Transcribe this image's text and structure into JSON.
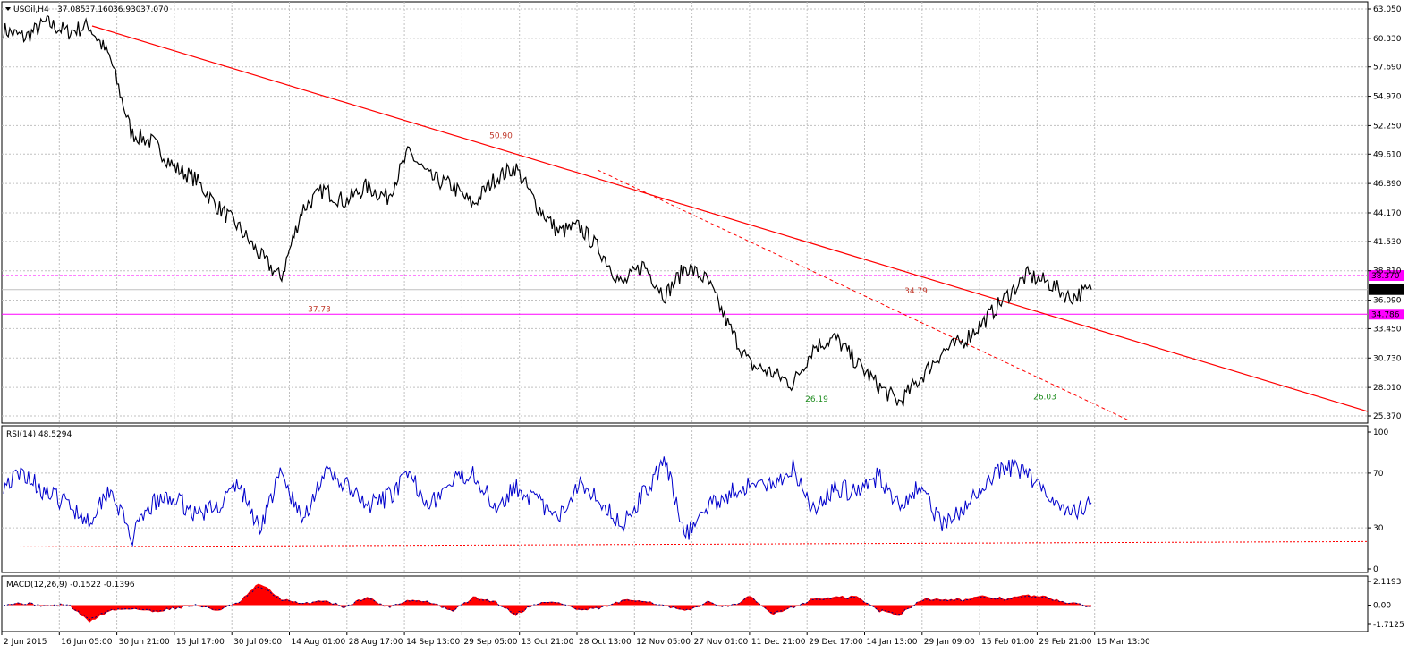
{
  "chart_data": {
    "type": "line",
    "symbol_label": "USOil,H4",
    "ohlc": [
      "37.085",
      "37.160",
      "36.930",
      "37.070"
    ],
    "price_axis": {
      "ticks": [
        "63.050",
        "60.330",
        "57.690",
        "54.970",
        "52.250",
        "49.610",
        "46.890",
        "44.170",
        "41.530",
        "38.810",
        "36.090",
        "33.450",
        "30.730",
        "28.010",
        "25.370"
      ],
      "ylim": [
        25.37,
        63.05
      ]
    },
    "x_ticks": [
      "2 Jun 2015",
      "16 Jun 05:00",
      "30 Jun 21:00",
      "15 Jul 17:00",
      "30 Jul 09:00",
      "14 Aug 01:00",
      "28 Aug 17:00",
      "14 Sep 13:00",
      "29 Sep 05:00",
      "13 Oct 21:00",
      "28 Oct 13:00",
      "12 Nov 05:00",
      "27 Nov 01:00",
      "11 Dec 21:00",
      "29 Dec 17:00",
      "14 Jan 13:00",
      "29 Jan 09:00",
      "15 Feb 01:00",
      "29 Feb 21:00",
      "15 Mar 13:00"
    ],
    "price_series_anchors": [
      61.1,
      60.4,
      61.8,
      60.9,
      61.5,
      58.5,
      51.5,
      50.7,
      48.4,
      47.3,
      44.8,
      42.9,
      40.3,
      38.1,
      44.5,
      46.3,
      45.2,
      46.6,
      45.6,
      49.8,
      47.4,
      46.7,
      44.9,
      47.3,
      48.4,
      44.9,
      42.4,
      42.9,
      40.6,
      37.5,
      39.4,
      36.5,
      39.2,
      37.9,
      33.7,
      30.1,
      29.4,
      28.3,
      31.8,
      32.6,
      30.3,
      28.2,
      26.6,
      28.9,
      31.3,
      32.3,
      34.2,
      36.4,
      38.4,
      37.7,
      36.3,
      37.07
    ],
    "annotations": [
      {
        "text": "50.90",
        "price": 51.1
      },
      {
        "text": "37.73",
        "price": 35.0
      },
      {
        "text": "34.79",
        "price": 36.7
      },
      {
        "text": "26.19",
        "price": 26.7
      },
      {
        "text": "26.03",
        "price": 26.9
      }
    ],
    "horizontal_lines": [
      {
        "label": "38.370",
        "price": 38.37,
        "color": "#ff00ff",
        "style": "dashed"
      },
      {
        "label": "37.070",
        "price": 37.07,
        "color": "#c0c0c0",
        "style": "solid"
      },
      {
        "label": "34.786",
        "price": 34.786,
        "color": "#ff00ff",
        "style": "solid"
      }
    ],
    "rsi": {
      "label": "RSI(14) 48.5294",
      "ticks": [
        "100",
        "70",
        "30",
        "0"
      ],
      "ylim": [
        0,
        100
      ],
      "anchors": [
        62,
        70,
        55,
        48,
        35,
        60,
        22,
        48,
        52,
        40,
        45,
        62,
        30,
        70,
        35,
        70,
        62,
        45,
        52,
        68,
        48,
        62,
        72,
        45,
        60,
        50,
        35,
        65,
        50,
        32,
        55,
        78,
        25,
        45,
        55,
        62,
        60,
        75,
        42,
        60,
        55,
        68,
        48,
        60,
        32,
        42,
        62,
        75,
        70,
        55,
        40,
        48.5
      ]
    },
    "macd": {
      "label": "MACD(12,26,9) -0.1522 -0.1396",
      "ticks": [
        "2.1193",
        "0.00",
        "-1.7125"
      ],
      "ylim": [
        -1.7125,
        2.1193
      ],
      "anchors": [
        0.1,
        0.2,
        -0.1,
        0.1,
        -1.5,
        -0.5,
        -0.3,
        -0.6,
        -0.3,
        0.0,
        -0.5,
        0.2,
        2.0,
        0.6,
        0.1,
        0.5,
        -0.2,
        0.8,
        -0.2,
        0.5,
        0.3,
        -0.6,
        0.7,
        0.4,
        -0.9,
        0.2,
        0.3,
        -0.5,
        -0.3,
        0.4,
        0.5,
        -0.1,
        -0.6,
        0.3,
        -0.2,
        0.8,
        -0.8,
        -0.2,
        0.6,
        0.7,
        0.8,
        -0.5,
        -0.9,
        0.5,
        0.6,
        0.5,
        0.8,
        0.6,
        0.9,
        0.7,
        0.2,
        -0.15
      ]
    },
    "colors": {
      "price": "#000000",
      "trendline": "#ff0000",
      "rsi": "#0000cc",
      "rsi_signal": "#ff0000",
      "macd_hist": "#ff0000",
      "macd_signal": "#000080",
      "grid": "#c0c0c0",
      "annotation_red": "#c0392b",
      "annotation_green": "#1e8c1e",
      "magenta": "#ff00ff"
    }
  }
}
